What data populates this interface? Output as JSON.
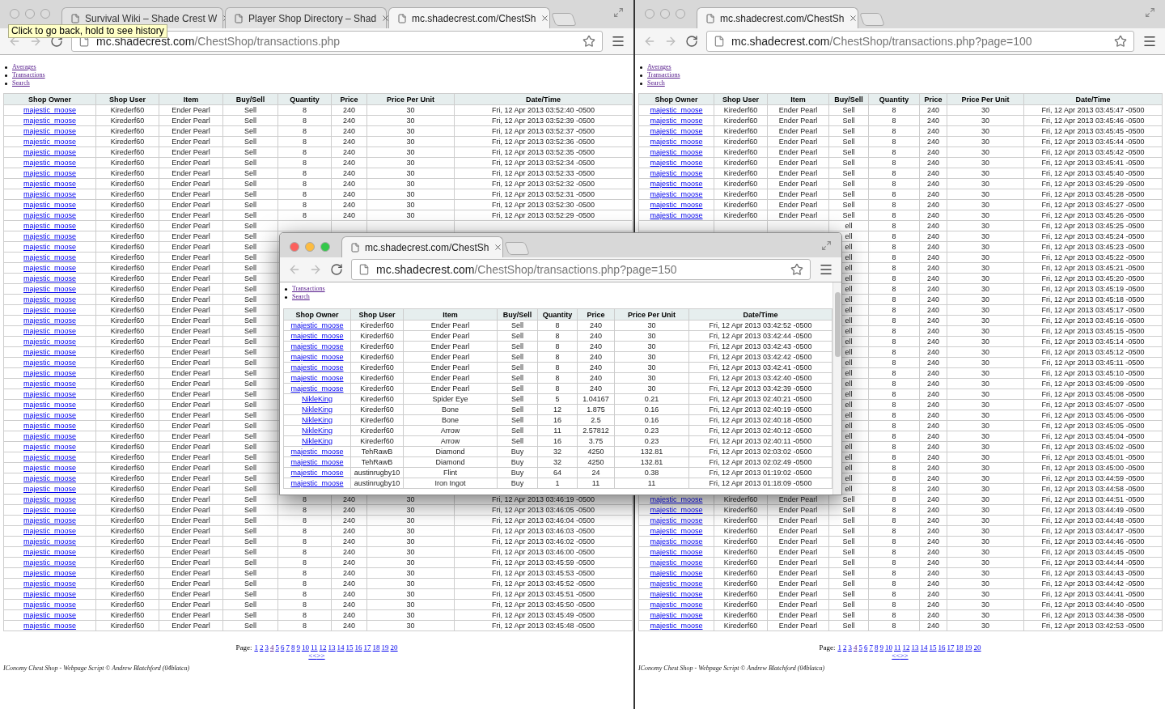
{
  "windows": [
    {
      "kind": "main",
      "active": false,
      "tabs": [
        {
          "title": "Survival Wiki – Shade Crest W",
          "selected": false
        },
        {
          "title": "Player Shop Directory – Shad",
          "selected": false
        },
        {
          "title": "mc.shadecrest.com/ChestSh",
          "selected": true
        }
      ],
      "tooltip": "Click to go back, hold to see history",
      "url": {
        "host": "mc.shadecrest.com",
        "path": "/ChestShop/transactions.php"
      },
      "nav_links": [
        "Averages",
        "Transactions",
        "Search"
      ],
      "table": {
        "columns": [
          "Shop Owner",
          "Shop User",
          "Item",
          "Buy/Sell",
          "Quantity",
          "Price",
          "Price Per Unit",
          "Date/Time"
        ],
        "rows": [
          [
            "majestic_moose",
            "Kirederf60",
            "Ender Pearl",
            "Sell",
            "8",
            "240",
            "30",
            "Fri, 12 Apr 2013 03:52:40 -0500"
          ],
          [
            "majestic_moose",
            "Kirederf60",
            "Ender Pearl",
            "Sell",
            "8",
            "240",
            "30",
            "Fri, 12 Apr 2013 03:52:39 -0500"
          ],
          [
            "majestic_moose",
            "Kirederf60",
            "Ender Pearl",
            "Sell",
            "8",
            "240",
            "30",
            "Fri, 12 Apr 2013 03:52:37 -0500"
          ],
          [
            "majestic_moose",
            "Kirederf60",
            "Ender Pearl",
            "Sell",
            "8",
            "240",
            "30",
            "Fri, 12 Apr 2013 03:52:36 -0500"
          ],
          [
            "majestic_moose",
            "Kirederf60",
            "Ender Pearl",
            "Sell",
            "8",
            "240",
            "30",
            "Fri, 12 Apr 2013 03:52:35 -0500"
          ],
          [
            "majestic_moose",
            "Kirederf60",
            "Ender Pearl",
            "Sell",
            "8",
            "240",
            "30",
            "Fri, 12 Apr 2013 03:52:34 -0500"
          ],
          [
            "majestic_moose",
            "Kirederf60",
            "Ender Pearl",
            "Sell",
            "8",
            "240",
            "30",
            "Fri, 12 Apr 2013 03:52:33 -0500"
          ],
          [
            "majestic_moose",
            "Kirederf60",
            "Ender Pearl",
            "Sell",
            "8",
            "240",
            "30",
            "Fri, 12 Apr 2013 03:52:32 -0500"
          ],
          [
            "majestic_moose",
            "Kirederf60",
            "Ender Pearl",
            "Sell",
            "8",
            "240",
            "30",
            "Fri, 12 Apr 2013 03:52:31 -0500"
          ],
          [
            "majestic_moose",
            "Kirederf60",
            "Ender Pearl",
            "Sell",
            "8",
            "240",
            "30",
            "Fri, 12 Apr 2013 03:52:30 -0500"
          ],
          [
            "majestic_moose",
            "Kirederf60",
            "Ender Pearl",
            "Sell",
            "8",
            "240",
            "30",
            "Fri, 12 Apr 2013 03:52:29 -0500"
          ],
          [
            "majestic_moose",
            "Kirederf60",
            "Ender Pearl",
            "Sell",
            null,
            null,
            null,
            null
          ],
          [
            "majestic_moose",
            "Kirederf60",
            "Ender Pearl",
            "Sell",
            null,
            null,
            null,
            null
          ],
          [
            "majestic_moose",
            "Kirederf60",
            "Ender Pearl",
            "Sell",
            null,
            null,
            null,
            null
          ],
          [
            "majestic_moose",
            "Kirederf60",
            "Ender Pearl",
            "Sell",
            null,
            null,
            null,
            null
          ],
          [
            "majestic_moose",
            "Kirederf60",
            "Ender Pearl",
            "Sell",
            null,
            null,
            null,
            null
          ],
          [
            "majestic_moose",
            "Kirederf60",
            "Ender Pearl",
            "Sell",
            null,
            null,
            null,
            null
          ],
          [
            "majestic_moose",
            "Kirederf60",
            "Ender Pearl",
            "Sell",
            null,
            null,
            null,
            null
          ],
          [
            "majestic_moose",
            "Kirederf60",
            "Ender Pearl",
            "Sell",
            null,
            null,
            null,
            null
          ],
          [
            "majestic_moose",
            "Kirederf60",
            "Ender Pearl",
            "Sell",
            null,
            null,
            null,
            null
          ],
          [
            "majestic_moose",
            "Kirederf60",
            "Ender Pearl",
            "Sell",
            null,
            null,
            null,
            null
          ],
          [
            "majestic_moose",
            "Kirederf60",
            "Ender Pearl",
            "Sell",
            null,
            null,
            null,
            null
          ],
          [
            "majestic_moose",
            "Kirederf60",
            "Ender Pearl",
            "Sell",
            null,
            null,
            null,
            null
          ],
          [
            "majestic_moose",
            "Kirederf60",
            "Ender Pearl",
            "Sell",
            null,
            null,
            null,
            null
          ],
          [
            "majestic_moose",
            "Kirederf60",
            "Ender Pearl",
            "Sell",
            null,
            null,
            null,
            null
          ],
          [
            "majestic_moose",
            "Kirederf60",
            "Ender Pearl",
            "Sell",
            null,
            null,
            null,
            null
          ],
          [
            "majestic_moose",
            "Kirederf60",
            "Ender Pearl",
            "Sell",
            null,
            null,
            null,
            null
          ],
          [
            "majestic_moose",
            "Kirederf60",
            "Ender Pearl",
            "Sell",
            null,
            null,
            null,
            null
          ],
          [
            "majestic_moose",
            "Kirederf60",
            "Ender Pearl",
            "Sell",
            null,
            null,
            null,
            null
          ],
          [
            "majestic_moose",
            "Kirederf60",
            "Ender Pearl",
            "Sell",
            null,
            null,
            null,
            null
          ],
          [
            "majestic_moose",
            "Kirederf60",
            "Ender Pearl",
            "Sell",
            null,
            null,
            null,
            null
          ],
          [
            "majestic_moose",
            "Kirederf60",
            "Ender Pearl",
            "Sell",
            null,
            null,
            null,
            null
          ],
          [
            "majestic_moose",
            "Kirederf60",
            "Ender Pearl",
            "Sell",
            null,
            null,
            null,
            null
          ],
          [
            "majestic_moose",
            "Kirederf60",
            "Ender Pearl",
            "Sell",
            null,
            null,
            null,
            null
          ],
          [
            "majestic_moose",
            "Kirederf60",
            "Ender Pearl",
            "Sell",
            null,
            null,
            null,
            null
          ],
          [
            "majestic_moose",
            "Kirederf60",
            "Ender Pearl",
            "Sell",
            null,
            null,
            null,
            null
          ],
          [
            "majestic_moose",
            "Kirederf60",
            "Ender Pearl",
            "Sell",
            null,
            null,
            null,
            null
          ],
          [
            "majestic_moose",
            "Kirederf60",
            "Ender Pearl",
            "Sell",
            "8",
            "240",
            "30",
            "Fri, 12 Apr 2013 03:46:19 -0500"
          ],
          [
            "majestic_moose",
            "Kirederf60",
            "Ender Pearl",
            "Sell",
            "8",
            "240",
            "30",
            "Fri, 12 Apr 2013 03:46:05 -0500"
          ],
          [
            "majestic_moose",
            "Kirederf60",
            "Ender Pearl",
            "Sell",
            "8",
            "240",
            "30",
            "Fri, 12 Apr 2013 03:46:04 -0500"
          ],
          [
            "majestic_moose",
            "Kirederf60",
            "Ender Pearl",
            "Sell",
            "8",
            "240",
            "30",
            "Fri, 12 Apr 2013 03:46:03 -0500"
          ],
          [
            "majestic_moose",
            "Kirederf60",
            "Ender Pearl",
            "Sell",
            "8",
            "240",
            "30",
            "Fri, 12 Apr 2013 03:46:02 -0500"
          ],
          [
            "majestic_moose",
            "Kirederf60",
            "Ender Pearl",
            "Sell",
            "8",
            "240",
            "30",
            "Fri, 12 Apr 2013 03:46:00 -0500"
          ],
          [
            "majestic_moose",
            "Kirederf60",
            "Ender Pearl",
            "Sell",
            "8",
            "240",
            "30",
            "Fri, 12 Apr 2013 03:45:59 -0500"
          ],
          [
            "majestic_moose",
            "Kirederf60",
            "Ender Pearl",
            "Sell",
            "8",
            "240",
            "30",
            "Fri, 12 Apr 2013 03:45:53 -0500"
          ],
          [
            "majestic_moose",
            "Kirederf60",
            "Ender Pearl",
            "Sell",
            "8",
            "240",
            "30",
            "Fri, 12 Apr 2013 03:45:52 -0500"
          ],
          [
            "majestic_moose",
            "Kirederf60",
            "Ender Pearl",
            "Sell",
            "8",
            "240",
            "30",
            "Fri, 12 Apr 2013 03:45:51 -0500"
          ],
          [
            "majestic_moose",
            "Kirederf60",
            "Ender Pearl",
            "Sell",
            "8",
            "240",
            "30",
            "Fri, 12 Apr 2013 03:45:50 -0500"
          ],
          [
            "majestic_moose",
            "Kirederf60",
            "Ender Pearl",
            "Sell",
            "8",
            "240",
            "30",
            "Fri, 12 Apr 2013 03:45:49 -0500"
          ],
          [
            "majestic_moose",
            "Kirederf60",
            "Ender Pearl",
            "Sell",
            "8",
            "240",
            "30",
            "Fri, 12 Apr 2013 03:45:48 -0500"
          ]
        ]
      },
      "pagination": {
        "label": "Page:",
        "pages": [
          {
            "label": "1",
            "visited": false
          },
          {
            "label": "2",
            "visited": false
          },
          {
            "label": "3",
            "visited": false
          },
          {
            "label": "4",
            "visited": true
          },
          {
            "label": "5",
            "visited": false
          },
          {
            "label": "6",
            "visited": false
          },
          {
            "label": "7",
            "visited": false
          },
          {
            "label": "8",
            "visited": false
          },
          {
            "label": "9",
            "visited": false
          },
          {
            "label": "10",
            "visited": false
          },
          {
            "label": "11",
            "visited": false
          },
          {
            "label": "12",
            "visited": false
          },
          {
            "label": "13",
            "visited": false
          },
          {
            "label": "14",
            "visited": false
          },
          {
            "label": "15",
            "visited": false
          },
          {
            "label": "16",
            "visited": false
          },
          {
            "label": "17",
            "visited": false
          },
          {
            "label": "18",
            "visited": false
          },
          {
            "label": "19",
            "visited": false
          },
          {
            "label": "20",
            "visited": false
          }
        ],
        "prev": "<<",
        "next": ">>"
      },
      "footer": "IConomy Chest Shop - Webpage Script © Andrew Blatchford (04blatca)"
    },
    {
      "kind": "main",
      "active": false,
      "tabs": [
        {
          "title": "mc.shadecrest.com/ChestSh",
          "selected": true
        }
      ],
      "url": {
        "host": "mc.shadecrest.com",
        "path": "/ChestShop/transactions.php?page=100"
      },
      "nav_links": [
        "Averages",
        "Transactions",
        "Search"
      ],
      "table": {
        "columns": [
          "Shop Owner",
          "Shop User",
          "Item",
          "Buy/Sell",
          "Quantity",
          "Price",
          "Price Per Unit",
          "Date/Time"
        ],
        "rows": [
          [
            "majestic_moose",
            "Kirederf60",
            "Ender Pearl",
            "Sell",
            "8",
            "240",
            "30",
            "Fri, 12 Apr 2013 03:45:47 -0500"
          ],
          [
            "majestic_moose",
            "Kirederf60",
            "Ender Pearl",
            "Sell",
            "8",
            "240",
            "30",
            "Fri, 12 Apr 2013 03:45:46 -0500"
          ],
          [
            "majestic_moose",
            "Kirederf60",
            "Ender Pearl",
            "Sell",
            "8",
            "240",
            "30",
            "Fri, 12 Apr 2013 03:45:45 -0500"
          ],
          [
            "majestic_moose",
            "Kirederf60",
            "Ender Pearl",
            "Sell",
            "8",
            "240",
            "30",
            "Fri, 12 Apr 2013 03:45:44 -0500"
          ],
          [
            "majestic_moose",
            "Kirederf60",
            "Ender Pearl",
            "Sell",
            "8",
            "240",
            "30",
            "Fri, 12 Apr 2013 03:45:42 -0500"
          ],
          [
            "majestic_moose",
            "Kirederf60",
            "Ender Pearl",
            "Sell",
            "8",
            "240",
            "30",
            "Fri, 12 Apr 2013 03:45:41 -0500"
          ],
          [
            "majestic_moose",
            "Kirederf60",
            "Ender Pearl",
            "Sell",
            "8",
            "240",
            "30",
            "Fri, 12 Apr 2013 03:45:40 -0500"
          ],
          [
            "majestic_moose",
            "Kirederf60",
            "Ender Pearl",
            "Sell",
            "8",
            "240",
            "30",
            "Fri, 12 Apr 2013 03:45:29 -0500"
          ],
          [
            "majestic_moose",
            "Kirederf60",
            "Ender Pearl",
            "Sell",
            "8",
            "240",
            "30",
            "Fri, 12 Apr 2013 03:45:28 -0500"
          ],
          [
            "majestic_moose",
            "Kirederf60",
            "Ender Pearl",
            "Sell",
            "8",
            "240",
            "30",
            "Fri, 12 Apr 2013 03:45:27 -0500"
          ],
          [
            "majestic_moose",
            "Kirederf60",
            "Ender Pearl",
            "Sell",
            "8",
            "240",
            "30",
            "Fri, 12 Apr 2013 03:45:26 -0500"
          ],
          [
            null,
            null,
            null,
            "ell",
            "8",
            "240",
            "30",
            "Fri, 12 Apr 2013 03:45:25 -0500"
          ],
          [
            null,
            null,
            null,
            "ell",
            "8",
            "240",
            "30",
            "Fri, 12 Apr 2013 03:45:24 -0500"
          ],
          [
            null,
            null,
            null,
            "ell",
            "8",
            "240",
            "30",
            "Fri, 12 Apr 2013 03:45:23 -0500"
          ],
          [
            null,
            null,
            null,
            "ell",
            "8",
            "240",
            "30",
            "Fri, 12 Apr 2013 03:45:22 -0500"
          ],
          [
            null,
            null,
            null,
            "ell",
            "8",
            "240",
            "30",
            "Fri, 12 Apr 2013 03:45:21 -0500"
          ],
          [
            null,
            null,
            null,
            "ell",
            "8",
            "240",
            "30",
            "Fri, 12 Apr 2013 03:45:20 -0500"
          ],
          [
            null,
            null,
            null,
            "ell",
            "8",
            "240",
            "30",
            "Fri, 12 Apr 2013 03:45:19 -0500"
          ],
          [
            null,
            null,
            null,
            "ell",
            "8",
            "240",
            "30",
            "Fri, 12 Apr 2013 03:45:18 -0500"
          ],
          [
            null,
            null,
            null,
            "ell",
            "8",
            "240",
            "30",
            "Fri, 12 Apr 2013 03:45:17 -0500"
          ],
          [
            null,
            null,
            null,
            "ell",
            "8",
            "240",
            "30",
            "Fri, 12 Apr 2013 03:45:16 -0500"
          ],
          [
            null,
            null,
            null,
            "ell",
            "8",
            "240",
            "30",
            "Fri, 12 Apr 2013 03:45:15 -0500"
          ],
          [
            null,
            null,
            null,
            "ell",
            "8",
            "240",
            "30",
            "Fri, 12 Apr 2013 03:45:14 -0500"
          ],
          [
            null,
            null,
            null,
            "ell",
            "8",
            "240",
            "30",
            "Fri, 12 Apr 2013 03:45:12 -0500"
          ],
          [
            null,
            null,
            null,
            "ell",
            "8",
            "240",
            "30",
            "Fri, 12 Apr 2013 03:45:11 -0500"
          ],
          [
            null,
            null,
            null,
            "ell",
            "8",
            "240",
            "30",
            "Fri, 12 Apr 2013 03:45:10 -0500"
          ],
          [
            null,
            null,
            null,
            "ell",
            "8",
            "240",
            "30",
            "Fri, 12 Apr 2013 03:45:09 -0500"
          ],
          [
            null,
            null,
            null,
            "ell",
            "8",
            "240",
            "30",
            "Fri, 12 Apr 2013 03:45:08 -0500"
          ],
          [
            null,
            null,
            null,
            "ell",
            "8",
            "240",
            "30",
            "Fri, 12 Apr 2013 03:45:07 -0500"
          ],
          [
            null,
            null,
            null,
            "ell",
            "8",
            "240",
            "30",
            "Fri, 12 Apr 2013 03:45:06 -0500"
          ],
          [
            null,
            null,
            null,
            "ell",
            "8",
            "240",
            "30",
            "Fri, 12 Apr 2013 03:45:05 -0500"
          ],
          [
            null,
            null,
            null,
            "ell",
            "8",
            "240",
            "30",
            "Fri, 12 Apr 2013 03:45:04 -0500"
          ],
          [
            null,
            null,
            null,
            "ell",
            "8",
            "240",
            "30",
            "Fri, 12 Apr 2013 03:45:02 -0500"
          ],
          [
            null,
            null,
            null,
            "ell",
            "8",
            "240",
            "30",
            "Fri, 12 Apr 2013 03:45:01 -0500"
          ],
          [
            null,
            null,
            null,
            "ell",
            "8",
            "240",
            "30",
            "Fri, 12 Apr 2013 03:45:00 -0500"
          ],
          [
            null,
            null,
            null,
            "ell",
            "8",
            "240",
            "30",
            "Fri, 12 Apr 2013 03:44:59 -0500"
          ],
          [
            null,
            null,
            null,
            "ell",
            "8",
            "240",
            "30",
            "Fri, 12 Apr 2013 03:44:58 -0500"
          ],
          [
            "majestic_moose",
            "Kirederf60",
            "Ender Pearl",
            "Sell",
            "8",
            "240",
            "30",
            "Fri, 12 Apr 2013 03:44:51 -0500"
          ],
          [
            "majestic_moose",
            "Kirederf60",
            "Ender Pearl",
            "Sell",
            "8",
            "240",
            "30",
            "Fri, 12 Apr 2013 03:44:49 -0500"
          ],
          [
            "majestic_moose",
            "Kirederf60",
            "Ender Pearl",
            "Sell",
            "8",
            "240",
            "30",
            "Fri, 12 Apr 2013 03:44:48 -0500"
          ],
          [
            "majestic_moose",
            "Kirederf60",
            "Ender Pearl",
            "Sell",
            "8",
            "240",
            "30",
            "Fri, 12 Apr 2013 03:44:47 -0500"
          ],
          [
            "majestic_moose",
            "Kirederf60",
            "Ender Pearl",
            "Sell",
            "8",
            "240",
            "30",
            "Fri, 12 Apr 2013 03:44:46 -0500"
          ],
          [
            "majestic_moose",
            "Kirederf60",
            "Ender Pearl",
            "Sell",
            "8",
            "240",
            "30",
            "Fri, 12 Apr 2013 03:44:45 -0500"
          ],
          [
            "majestic_moose",
            "Kirederf60",
            "Ender Pearl",
            "Sell",
            "8",
            "240",
            "30",
            "Fri, 12 Apr 2013 03:44:44 -0500"
          ],
          [
            "majestic_moose",
            "Kirederf60",
            "Ender Pearl",
            "Sell",
            "8",
            "240",
            "30",
            "Fri, 12 Apr 2013 03:44:43 -0500"
          ],
          [
            "majestic_moose",
            "Kirederf60",
            "Ender Pearl",
            "Sell",
            "8",
            "240",
            "30",
            "Fri, 12 Apr 2013 03:44:42 -0500"
          ],
          [
            "majestic_moose",
            "Kirederf60",
            "Ender Pearl",
            "Sell",
            "8",
            "240",
            "30",
            "Fri, 12 Apr 2013 03:44:41 -0500"
          ],
          [
            "majestic_moose",
            "Kirederf60",
            "Ender Pearl",
            "Sell",
            "8",
            "240",
            "30",
            "Fri, 12 Apr 2013 03:44:40 -0500"
          ],
          [
            "majestic_moose",
            "Kirederf60",
            "Ender Pearl",
            "Sell",
            "8",
            "240",
            "30",
            "Fri, 12 Apr 2013 03:44:38 -0500"
          ],
          [
            "majestic_moose",
            "Kirederf60",
            "Ender Pearl",
            "Sell",
            "8",
            "240",
            "30",
            "Fri, 12 Apr 2013 03:42:53 -0500"
          ]
        ]
      },
      "pagination": {
        "label": "Page:",
        "pages": [
          {
            "label": "1",
            "visited": false
          },
          {
            "label": "2",
            "visited": false
          },
          {
            "label": "3",
            "visited": false
          },
          {
            "label": "4",
            "visited": true
          },
          {
            "label": "5",
            "visited": false
          },
          {
            "label": "6",
            "visited": false
          },
          {
            "label": "7",
            "visited": false
          },
          {
            "label": "8",
            "visited": false
          },
          {
            "label": "9",
            "visited": false
          },
          {
            "label": "10",
            "visited": false
          },
          {
            "label": "11",
            "visited": false
          },
          {
            "label": "12",
            "visited": false
          },
          {
            "label": "13",
            "visited": false
          },
          {
            "label": "14",
            "visited": false
          },
          {
            "label": "15",
            "visited": false
          },
          {
            "label": "16",
            "visited": false
          },
          {
            "label": "17",
            "visited": false
          },
          {
            "label": "18",
            "visited": false
          },
          {
            "label": "19",
            "visited": false
          },
          {
            "label": "20",
            "visited": false
          }
        ],
        "prev": "<<",
        "next": ">>"
      },
      "footer": "IConomy Chest Shop - Webpage Script © Andrew Blatchford (04blatca)"
    },
    {
      "kind": "floating",
      "active": true,
      "tabs": [
        {
          "title": "mc.shadecrest.com/ChestSh",
          "selected": true
        }
      ],
      "url": {
        "host": "mc.shadecrest.com",
        "path": "/ChestShop/transactions.php?page=150"
      },
      "nav_links": [
        "Transactions",
        "Search"
      ],
      "table": {
        "columns": [
          "Shop Owner",
          "Shop User",
          "Item",
          "Buy/Sell",
          "Quantity",
          "Price",
          "Price Per Unit",
          "Date/Time"
        ],
        "rows": [
          [
            "majestic_moose",
            "Kirederf60",
            "Ender Pearl",
            "Sell",
            "8",
            "240",
            "30",
            "Fri, 12 Apr 2013 03:42:52 -0500"
          ],
          [
            "majestic_moose",
            "Kirederf60",
            "Ender Pearl",
            "Sell",
            "8",
            "240",
            "30",
            "Fri, 12 Apr 2013 03:42:44 -0500"
          ],
          [
            "majestic_moose",
            "Kirederf60",
            "Ender Pearl",
            "Sell",
            "8",
            "240",
            "30",
            "Fri, 12 Apr 2013 03:42:43 -0500"
          ],
          [
            "majestic_moose",
            "Kirederf60",
            "Ender Pearl",
            "Sell",
            "8",
            "240",
            "30",
            "Fri, 12 Apr 2013 03:42:42 -0500"
          ],
          [
            "majestic_moose",
            "Kirederf60",
            "Ender Pearl",
            "Sell",
            "8",
            "240",
            "30",
            "Fri, 12 Apr 2013 03:42:41 -0500"
          ],
          [
            "majestic_moose",
            "Kirederf60",
            "Ender Pearl",
            "Sell",
            "8",
            "240",
            "30",
            "Fri, 12 Apr 2013 03:42:40 -0500"
          ],
          [
            "majestic_moose",
            "Kirederf60",
            "Ender Pearl",
            "Sell",
            "8",
            "240",
            "30",
            "Fri, 12 Apr 2013 03:42:39 -0500"
          ],
          [
            "NikleKing",
            "Kirederf60",
            "Spider Eye",
            "Sell",
            "5",
            "1.04167",
            "0.21",
            "Fri, 12 Apr 2013 02:40:21 -0500"
          ],
          [
            "NikleKing",
            "Kirederf60",
            "Bone",
            "Sell",
            "12",
            "1.875",
            "0.16",
            "Fri, 12 Apr 2013 02:40:19 -0500"
          ],
          [
            "NikleKing",
            "Kirederf60",
            "Bone",
            "Sell",
            "16",
            "2.5",
            "0.16",
            "Fri, 12 Apr 2013 02:40:18 -0500"
          ],
          [
            "NikleKing",
            "Kirederf60",
            "Arrow",
            "Sell",
            "11",
            "2.57812",
            "0.23",
            "Fri, 12 Apr 2013 02:40:12 -0500"
          ],
          [
            "NikleKing",
            "Kirederf60",
            "Arrow",
            "Sell",
            "16",
            "3.75",
            "0.23",
            "Fri, 12 Apr 2013 02:40:11 -0500"
          ],
          [
            "majestic_moose",
            "TehRawB",
            "Diamond",
            "Buy",
            "32",
            "4250",
            "132.81",
            "Fri, 12 Apr 2013 02:03:02 -0500"
          ],
          [
            "majestic_moose",
            "TehRawB",
            "Diamond",
            "Buy",
            "32",
            "4250",
            "132.81",
            "Fri, 12 Apr 2013 02:02:49 -0500"
          ],
          [
            "majestic_moose",
            "austinrugby10",
            "Flint",
            "Buy",
            "64",
            "24",
            "0.38",
            "Fri, 12 Apr 2013 01:19:02 -0500"
          ],
          [
            "majestic_moose",
            "austinrugby10",
            "Iron Ingot",
            "Buy",
            "1",
            "11",
            "11",
            "Fri, 12 Apr 2013 01:18:09 -0500"
          ]
        ]
      }
    }
  ]
}
